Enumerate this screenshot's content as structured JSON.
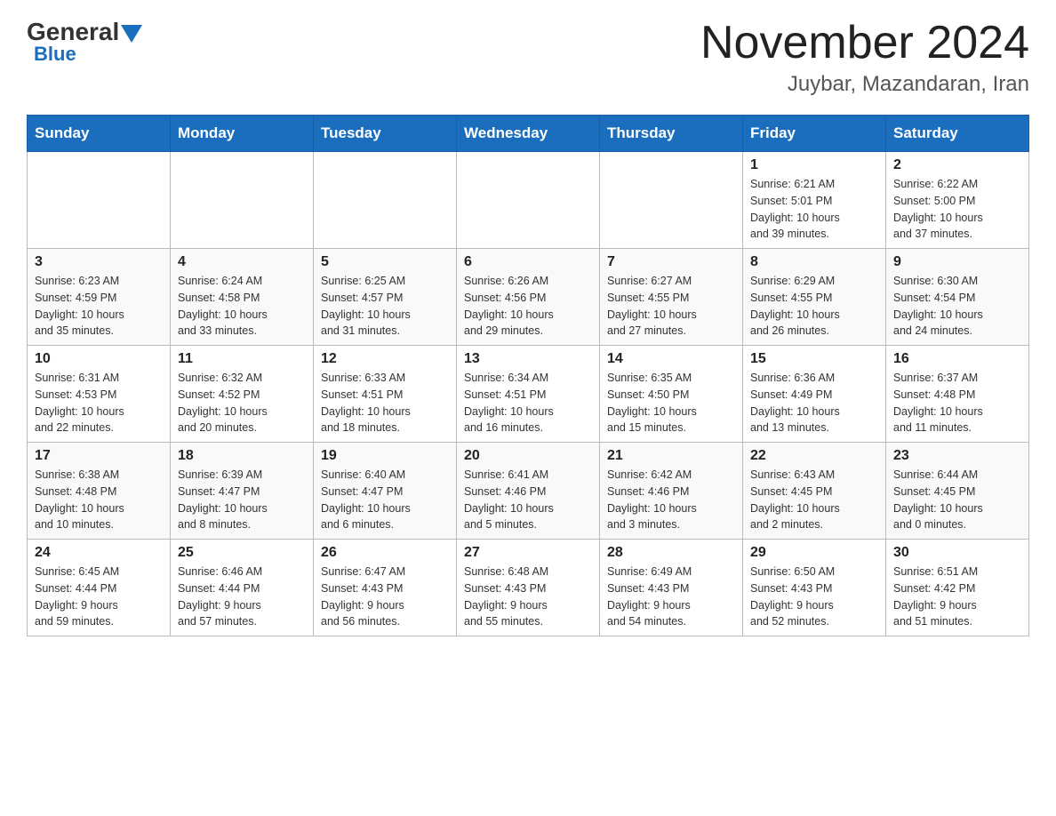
{
  "header": {
    "logo_general": "General",
    "logo_blue": "Blue",
    "month_title": "November 2024",
    "location": "Juybar, Mazandaran, Iran"
  },
  "weekdays": [
    "Sunday",
    "Monday",
    "Tuesday",
    "Wednesday",
    "Thursday",
    "Friday",
    "Saturday"
  ],
  "weeks": [
    [
      {
        "day": "",
        "info": ""
      },
      {
        "day": "",
        "info": ""
      },
      {
        "day": "",
        "info": ""
      },
      {
        "day": "",
        "info": ""
      },
      {
        "day": "",
        "info": ""
      },
      {
        "day": "1",
        "info": "Sunrise: 6:21 AM\nSunset: 5:01 PM\nDaylight: 10 hours\nand 39 minutes."
      },
      {
        "day": "2",
        "info": "Sunrise: 6:22 AM\nSunset: 5:00 PM\nDaylight: 10 hours\nand 37 minutes."
      }
    ],
    [
      {
        "day": "3",
        "info": "Sunrise: 6:23 AM\nSunset: 4:59 PM\nDaylight: 10 hours\nand 35 minutes."
      },
      {
        "day": "4",
        "info": "Sunrise: 6:24 AM\nSunset: 4:58 PM\nDaylight: 10 hours\nand 33 minutes."
      },
      {
        "day": "5",
        "info": "Sunrise: 6:25 AM\nSunset: 4:57 PM\nDaylight: 10 hours\nand 31 minutes."
      },
      {
        "day": "6",
        "info": "Sunrise: 6:26 AM\nSunset: 4:56 PM\nDaylight: 10 hours\nand 29 minutes."
      },
      {
        "day": "7",
        "info": "Sunrise: 6:27 AM\nSunset: 4:55 PM\nDaylight: 10 hours\nand 27 minutes."
      },
      {
        "day": "8",
        "info": "Sunrise: 6:29 AM\nSunset: 4:55 PM\nDaylight: 10 hours\nand 26 minutes."
      },
      {
        "day": "9",
        "info": "Sunrise: 6:30 AM\nSunset: 4:54 PM\nDaylight: 10 hours\nand 24 minutes."
      }
    ],
    [
      {
        "day": "10",
        "info": "Sunrise: 6:31 AM\nSunset: 4:53 PM\nDaylight: 10 hours\nand 22 minutes."
      },
      {
        "day": "11",
        "info": "Sunrise: 6:32 AM\nSunset: 4:52 PM\nDaylight: 10 hours\nand 20 minutes."
      },
      {
        "day": "12",
        "info": "Sunrise: 6:33 AM\nSunset: 4:51 PM\nDaylight: 10 hours\nand 18 minutes."
      },
      {
        "day": "13",
        "info": "Sunrise: 6:34 AM\nSunset: 4:51 PM\nDaylight: 10 hours\nand 16 minutes."
      },
      {
        "day": "14",
        "info": "Sunrise: 6:35 AM\nSunset: 4:50 PM\nDaylight: 10 hours\nand 15 minutes."
      },
      {
        "day": "15",
        "info": "Sunrise: 6:36 AM\nSunset: 4:49 PM\nDaylight: 10 hours\nand 13 minutes."
      },
      {
        "day": "16",
        "info": "Sunrise: 6:37 AM\nSunset: 4:48 PM\nDaylight: 10 hours\nand 11 minutes."
      }
    ],
    [
      {
        "day": "17",
        "info": "Sunrise: 6:38 AM\nSunset: 4:48 PM\nDaylight: 10 hours\nand 10 minutes."
      },
      {
        "day": "18",
        "info": "Sunrise: 6:39 AM\nSunset: 4:47 PM\nDaylight: 10 hours\nand 8 minutes."
      },
      {
        "day": "19",
        "info": "Sunrise: 6:40 AM\nSunset: 4:47 PM\nDaylight: 10 hours\nand 6 minutes."
      },
      {
        "day": "20",
        "info": "Sunrise: 6:41 AM\nSunset: 4:46 PM\nDaylight: 10 hours\nand 5 minutes."
      },
      {
        "day": "21",
        "info": "Sunrise: 6:42 AM\nSunset: 4:46 PM\nDaylight: 10 hours\nand 3 minutes."
      },
      {
        "day": "22",
        "info": "Sunrise: 6:43 AM\nSunset: 4:45 PM\nDaylight: 10 hours\nand 2 minutes."
      },
      {
        "day": "23",
        "info": "Sunrise: 6:44 AM\nSunset: 4:45 PM\nDaylight: 10 hours\nand 0 minutes."
      }
    ],
    [
      {
        "day": "24",
        "info": "Sunrise: 6:45 AM\nSunset: 4:44 PM\nDaylight: 9 hours\nand 59 minutes."
      },
      {
        "day": "25",
        "info": "Sunrise: 6:46 AM\nSunset: 4:44 PM\nDaylight: 9 hours\nand 57 minutes."
      },
      {
        "day": "26",
        "info": "Sunrise: 6:47 AM\nSunset: 4:43 PM\nDaylight: 9 hours\nand 56 minutes."
      },
      {
        "day": "27",
        "info": "Sunrise: 6:48 AM\nSunset: 4:43 PM\nDaylight: 9 hours\nand 55 minutes."
      },
      {
        "day": "28",
        "info": "Sunrise: 6:49 AM\nSunset: 4:43 PM\nDaylight: 9 hours\nand 54 minutes."
      },
      {
        "day": "29",
        "info": "Sunrise: 6:50 AM\nSunset: 4:43 PM\nDaylight: 9 hours\nand 52 minutes."
      },
      {
        "day": "30",
        "info": "Sunrise: 6:51 AM\nSunset: 4:42 PM\nDaylight: 9 hours\nand 51 minutes."
      }
    ]
  ]
}
